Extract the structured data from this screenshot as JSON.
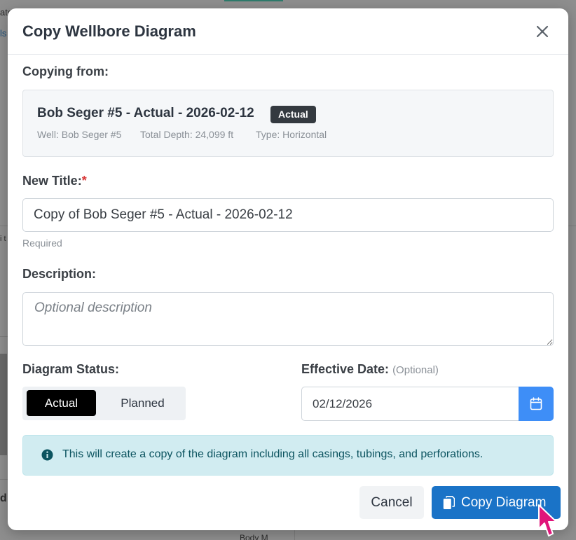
{
  "background": {
    "fragments": [
      "ate",
      "ls",
      "i t",
      "d -",
      "Body M"
    ]
  },
  "modal": {
    "title": "Copy Wellbore Diagram",
    "close_icon": "close-icon"
  },
  "copying_from": {
    "label": "Copying from:",
    "title": "Bob Seger #5 - Actual - 2026-02-12",
    "badge": "Actual",
    "well": "Well: Bob Seger #5",
    "total_depth": "Total Depth: 24,099 ft",
    "type": "Type: Horizontal"
  },
  "new_title": {
    "label": "New Title:",
    "required_mark": "*",
    "value": "Copy of Bob Seger #5 - Actual - 2026-02-12",
    "hint": "Required"
  },
  "description": {
    "label": "Description:",
    "placeholder": "Optional description",
    "value": ""
  },
  "diagram_status": {
    "label": "Diagram Status:",
    "options": [
      "Actual",
      "Planned"
    ],
    "selected": "Actual"
  },
  "effective_date": {
    "label": "Effective Date:",
    "optional_note": "(Optional)",
    "value": "02/12/2026",
    "calendar_icon": "calendar-icon"
  },
  "info": {
    "icon": "info-circle-icon",
    "text": "This will create a copy of the diagram including all casings, tubings, and perforations."
  },
  "footer": {
    "cancel_label": "Cancel",
    "copy_label": "Copy Diagram",
    "copy_icon": "copy-icon"
  },
  "colors": {
    "primary_button": "#1a73c7",
    "calendar_button": "#3e8ef7",
    "badge_bg": "#343a40",
    "info_bg": "#d1ecf1",
    "info_text": "#0c5460",
    "required_star": "#d93a3a",
    "cursor": "#e0157a"
  }
}
